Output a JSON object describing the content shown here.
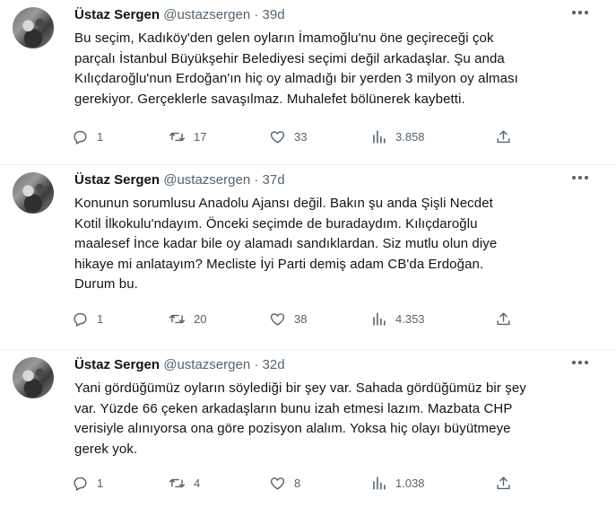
{
  "tweets": [
    {
      "name": "Üstaz Sergen",
      "handle": "@ustazsergen",
      "separator": "·",
      "time": "39d",
      "lines": [
        "Bu seçim, Kadıköy'den gelen oyların İmamoğlu'nu öne geçireceği çok",
        "parçalı İstanbul Büyükşehir Belediyesi seçimi değil arkadaşlar. Şu anda",
        "Kılıçdaroğlu'nun Erdoğan'ın hiç oy almadığı bir yerden 3 milyon oy alması",
        "gerekiyor. Gerçeklerle savaşılmaz. Muhalefet bölünerek kaybetti."
      ],
      "replies": "1",
      "retweets": "17",
      "likes": "33",
      "views": "3.858"
    },
    {
      "name": "Üstaz Sergen",
      "handle": "@ustazsergen",
      "separator": "·",
      "time": "37d",
      "lines": [
        "Konunun sorumlusu Anadolu Ajansı değil. Bakın şu anda Şişli Necdet",
        "Kotil İlkokulu'ndayım. Önceki seçimde de buradaydım. Kılıçdaroğlu",
        "maalesef İnce kadar bile oy alamadı sandıklardan. Siz mutlu olun diye",
        "hikaye mi anlatayım? Mecliste İyi Parti demiş adam CB'da Erdoğan.",
        "Durum bu."
      ],
      "replies": "1",
      "retweets": "20",
      "likes": "38",
      "views": "4.353"
    },
    {
      "name": "Üstaz Sergen",
      "handle": "@ustazsergen",
      "separator": "·",
      "time": "32d",
      "lines": [
        "Yani gördüğümüz oyların söylediği bir şey var. Sahada gördüğümüz bir şey",
        "var. Yüzde 66 çeken arkadaşların bunu izah etmesi lazım. Mazbata CHP",
        "verisiyle alınıyorsa ona göre pozisyon alalım. Yoksa hiç olayı büyütmeye",
        "gerek yok."
      ],
      "replies": "1",
      "retweets": "4",
      "likes": "8",
      "views": "1.038"
    }
  ],
  "icons": {
    "reply": "reply-icon",
    "retweet": "retweet-icon",
    "like": "heart-icon",
    "views": "views-icon",
    "share": "share-icon",
    "more": "more-icon"
  },
  "colors": {
    "text": "#0f1419",
    "secondary": "#536471",
    "divider": "#eff3f4"
  }
}
